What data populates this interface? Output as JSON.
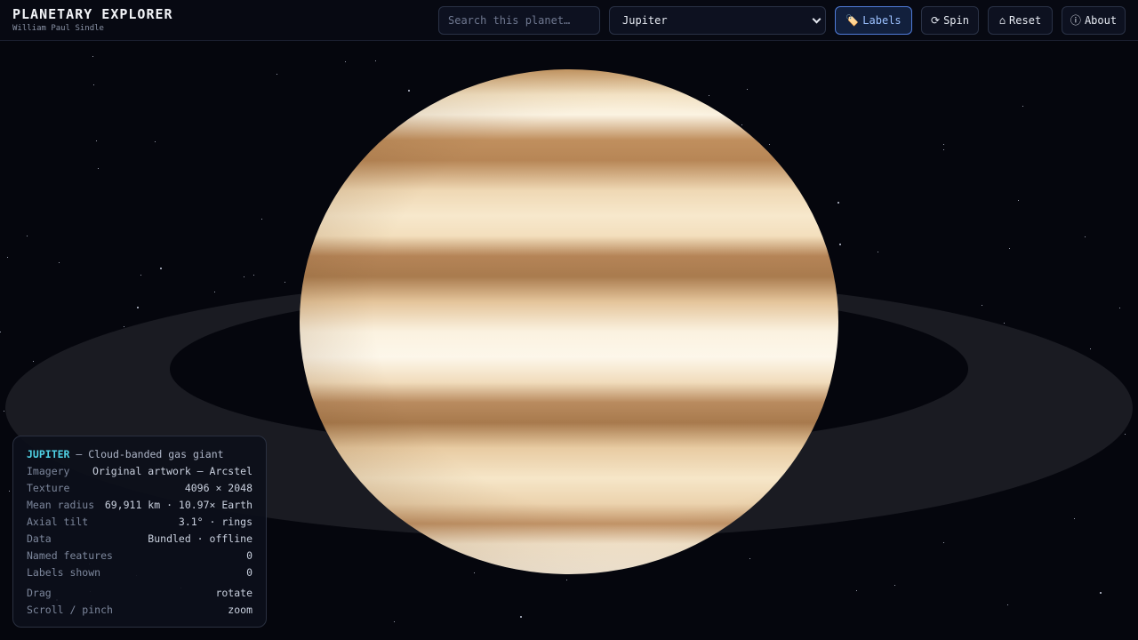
{
  "app": {
    "title": "PLANETARY EXPLORER",
    "author": "William Paul Sindle"
  },
  "search": {
    "placeholder": "Search this planet…",
    "value": ""
  },
  "planet_select": {
    "selected": "Jupiter"
  },
  "toolbar": {
    "labels": {
      "icon": "🏷️",
      "label": "Labels",
      "active": true
    },
    "spin": {
      "icon": "⟳",
      "label": "Spin"
    },
    "reset": {
      "icon": "⌂",
      "label": "Reset"
    },
    "about": {
      "icon": "ⓘ",
      "label": "About"
    }
  },
  "info": {
    "name": "JUPITER",
    "description": "— Cloud-banded gas giant",
    "rows": [
      {
        "key": "Imagery",
        "value": "Original artwork — Arcstel"
      },
      {
        "key": "Texture",
        "value": "4096 × 2048"
      },
      {
        "key": "Mean radius",
        "value": "69,911 km · 10.97× Earth"
      },
      {
        "key": "Axial tilt",
        "value": "3.1° · rings"
      },
      {
        "key": "Data",
        "value": "Bundled · offline"
      },
      {
        "key": "Named features",
        "value": "0"
      },
      {
        "key": "Labels shown",
        "value": "0"
      }
    ],
    "controls": [
      {
        "key": "Drag",
        "value": "rotate"
      },
      {
        "key": "Scroll / pinch",
        "value": "zoom"
      }
    ]
  },
  "colors": {
    "accent": "#4fd2e6",
    "active_button": "#9cc1ff",
    "background": "#05060d"
  }
}
